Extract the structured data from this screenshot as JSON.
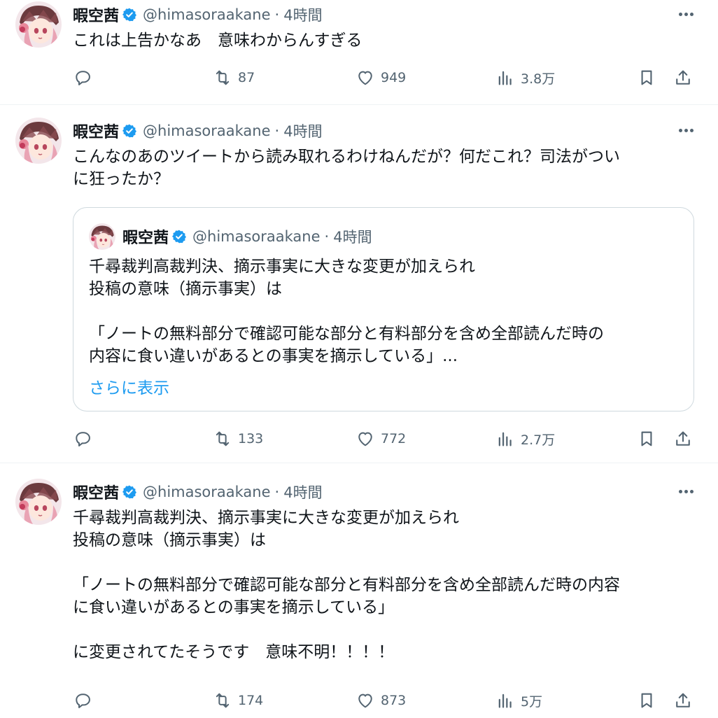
{
  "tweets": [
    {
      "name": "暇空茜",
      "handle": "@himasoraakane",
      "time": "4時間",
      "text": "これは上告かなあ　意味わからんすぎる",
      "replies": "",
      "retweets": "87",
      "likes": "949",
      "views": "3.8万"
    },
    {
      "name": "暇空茜",
      "handle": "@himasoraakane",
      "time": "4時間",
      "text": "こんなのあのツイートから読み取れるわけねんだが？何だこれ？司法がつい\nに狂ったか？",
      "quote": {
        "name": "暇空茜",
        "handle": "@himasoraakane",
        "time": "4時間",
        "text": "千尋裁判高裁判決、摘示事実に大きな変更が加えられ\n投稿の意味（摘示事実）は\n\n「ノートの無料部分で確認可能な部分と有料部分を含め全部読んだ時の\n内容に食い違いがあるとの事実を摘示している」...",
        "show_more": "さらに表示"
      },
      "replies": "",
      "retweets": "133",
      "likes": "772",
      "views": "2.7万"
    },
    {
      "name": "暇空茜",
      "handle": "@himasoraakane",
      "time": "4時間",
      "text": "千尋裁判高裁判決、摘示事実に大きな変更が加えられ\n投稿の意味（摘示事実）は\n\n「ノートの無料部分で確認可能な部分と有料部分を含め全部読んだ時の内容\nに食い違いがあるとの事実を摘示している」\n\nに変更されてたそうです　意味不明！！！！",
      "replies": "",
      "retweets": "174",
      "likes": "873",
      "views": "5万"
    }
  ],
  "separator": "·",
  "icons": {
    "reply": "reply-icon",
    "retweet": "retweet-icon",
    "like": "heart-icon",
    "views": "views-icon",
    "bookmark": "bookmark-icon",
    "share": "share-icon",
    "verified": "verified-badge-icon",
    "more": "more-icon"
  },
  "colors": {
    "accent": "#1d9bf0",
    "muted": "#536471",
    "text": "#0f1419",
    "border": "#cfd9de"
  }
}
